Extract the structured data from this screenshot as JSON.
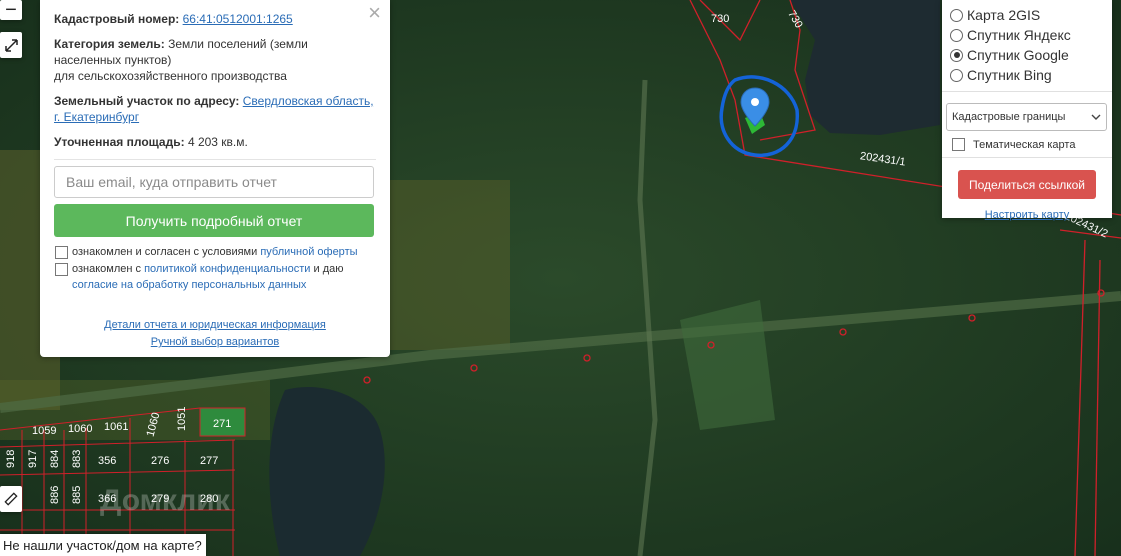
{
  "info_panel": {
    "cadastral_label": "Кадастровый номер:",
    "cadastral_number": "66:41:0512001:1265",
    "category_label": "Категория земель:",
    "category_value_line1": "Земли поселений (земли",
    "category_value_line2": "населенных пунктов)",
    "category_value_line3": "для сельскохозяйственного производства",
    "address_label": "Земельный участок по адресу:",
    "address_line1": "Свердловская область,",
    "address_line2": "г. Екатеринбург",
    "area_label": "Уточненная площадь:",
    "area_value": "4 203 кв.м.",
    "email_placeholder": "Ваш email, куда отправить отчет",
    "report_button": "Получить подробный отчет",
    "consent1_text": "ознакомлен и согласен с условиями",
    "consent1_link": "публичной оферты",
    "consent2_text": "ознакомлен с",
    "consent2_link": "политикой конфиденциальности",
    "consent2_mid": "и даю",
    "consent2_link2": "согласие на обработку персональных данных",
    "details_link": "Детали отчета и юридическая информация",
    "manual_link": "Ручной выбор вариантов"
  },
  "layer_panel": {
    "options": [
      {
        "label": "Карта 2GIS",
        "selected": false
      },
      {
        "label": "Спутник Яндекс",
        "selected": false
      },
      {
        "label": "Спутник Google",
        "selected": true
      },
      {
        "label": "Спутник Bing",
        "selected": false
      }
    ],
    "layer_select": "Кадастровые границы",
    "thematic_label": "Тематическая карта",
    "share_button": "Поделиться ссылкой",
    "configure_link": "Настроить карту"
  },
  "map": {
    "parcel_labels": [
      "730",
      "730",
      "202431/1",
      "202431/2",
      "271",
      "1059",
      "1060",
      "1061",
      "1060",
      "1051",
      "918",
      "917",
      "884",
      "883",
      "356",
      "276",
      "277",
      "886",
      "885",
      "366",
      "279",
      "280"
    ],
    "watermark": "Домклик",
    "colors": {
      "forest": "#203a24",
      "water": "#1d2a30",
      "boundary": "#d0202a",
      "marker": "#3a8ee6",
      "selection": "#1463d8",
      "green_parcel": "#2e8b3d"
    }
  },
  "not_found_bar": "Не нашли участок/дом на карте?"
}
